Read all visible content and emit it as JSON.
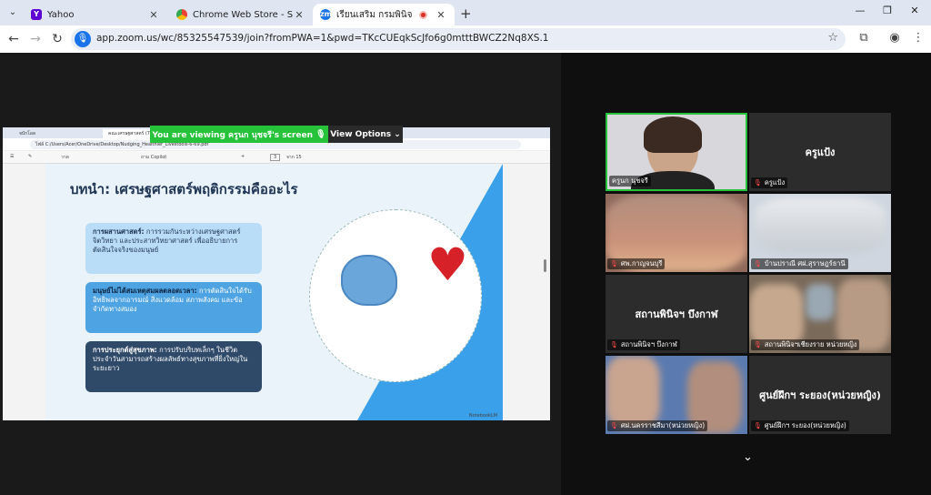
{
  "browser": {
    "tabs": [
      {
        "title": "Yahoo",
        "favicon": "Y",
        "color": "#6001d2"
      },
      {
        "title": "Chrome Web Store - Search Re",
        "favicon": "web-store-icon",
        "color": "#e0622f"
      },
      {
        "title": "เรียนเสริม กรมพินิจ",
        "favicon": "zm",
        "color": "#1a73e8"
      }
    ],
    "url": "app.zoom.us/wc/85325547539/join?fromPWA=1&pwd=TKcCUEqkScJfo6g0mtttBWCZ2Nq8XS.1"
  },
  "share": {
    "viewing_label": "You are viewing  ครูนก นุชจรี's screen",
    "view_options": "View Options"
  },
  "shared_screen": {
    "tabs": [
      "จบักโอล",
      "คณะเศรษฐศาสตร์ (717)"
    ],
    "file_path": "ไฟล์   C:/Users/Acer/OneDrive/Desktop/Nudging_Healthier_Livestools-6-69.pdf",
    "pdf_toolbar": {
      "draw": "วาด",
      "copilot": "ถาม Copilot",
      "page": "3",
      "page_of": "จาก 15"
    },
    "slide": {
      "title": "บทนำ: เศรษฐศาสตร์พฤติกรรมคืออะไร",
      "cards": [
        {
          "heading": "การผสานศาสตร์:",
          "body": " การรวมกันระหว่างเศรษฐศาสตร์ จิตวิทยา และประสาทวิทยาศาสตร์ เพื่ออธิบายการตัดสินใจจริงของมนุษย์"
        },
        {
          "heading": "มนุษย์ไม่ได้สมเหตุสมผลตลอดเวลา:",
          "body": " การตัดสินใจได้รับอิทธิพลจากอารมณ์ สิ่งแวดล้อม สภาพสังคม และข้อจำกัดทางสมอง"
        },
        {
          "heading": "การประยุกต์สู่สุขภาพ:",
          "body": " การปรับบริบทเล็กๆ ในชีวิตประจำวันสามารถสร้างผลลัพธ์ทางสุขภาพที่ยิ่งใหญ่ในระยะยาว"
        }
      ],
      "watermark": "NotebookLM"
    }
  },
  "participants": [
    {
      "name": "ครูนก นุชจรี",
      "muted": false,
      "video": true,
      "center": ""
    },
    {
      "name": "ครูแป้ง",
      "muted": true,
      "video": false,
      "center": "ครูแป้ง"
    },
    {
      "name": "ศพ.กาญจนบุรี",
      "muted": true,
      "video": true,
      "center": ""
    },
    {
      "name": "บ้านปราณี ศฝ.สุราษฎร์ธานี",
      "muted": true,
      "video": true,
      "center": ""
    },
    {
      "name": "สถานพินิจฯ บึงกาฬ",
      "muted": true,
      "video": false,
      "center": "สถานพินิจฯ บึงกาฬ"
    },
    {
      "name": "สถานพินิจฯเชียงราย หน่วยหญิง",
      "muted": true,
      "video": true,
      "center": ""
    },
    {
      "name": "ศฝ.นครราชสีมา(หน่วยหญิง)",
      "muted": true,
      "video": true,
      "center": ""
    },
    {
      "name": "ศูนย์ฝึกฯ ระยอง(หน่วยหญิง)",
      "muted": true,
      "video": false,
      "center": "ศูนย์ฝึกฯ ระยอง(หน่วยหญิง)"
    }
  ]
}
